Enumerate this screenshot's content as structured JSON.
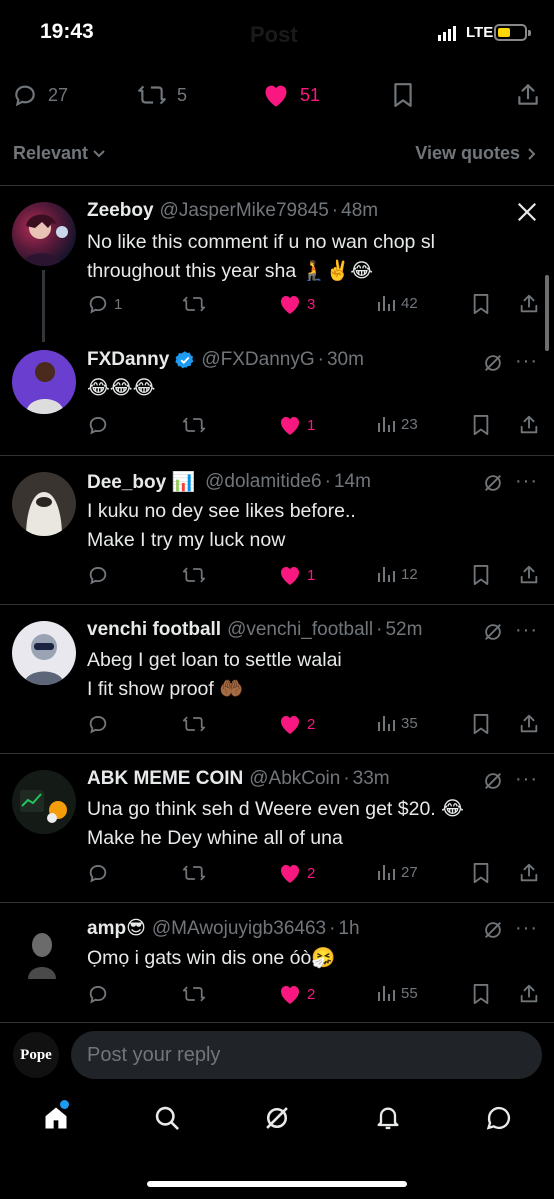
{
  "status_bar": {
    "time": "19:43",
    "network": "LTE",
    "ghost_title": "Post"
  },
  "post_actions": {
    "replies": "27",
    "reposts": "5",
    "likes": "51"
  },
  "sort": {
    "label": "Relevant",
    "view_quotes": "View quotes"
  },
  "tweets": [
    {
      "name": "Zeeboy",
      "handle": "@JasperMike79845",
      "ago": "48m",
      "lines": [
        "No like this comment if u no wan chop sl",
        "throughout this year sha 🧎✌️😂"
      ],
      "replies": "1",
      "reposts": "",
      "likes": "3",
      "views": "42"
    },
    {
      "name": "FXDanny",
      "handle": "@FXDannyG",
      "ago": "30m",
      "lines": [
        "😂😂😂"
      ],
      "replies": "",
      "reposts": "",
      "likes": "1",
      "views": "23"
    },
    {
      "name": "Dee_boy 📊",
      "handle": "@dolamitide6",
      "ago": "14m",
      "lines": [
        "I kuku no dey see likes before..",
        "Make I try my luck now"
      ],
      "replies": "",
      "reposts": "",
      "likes": "1",
      "views": "12"
    },
    {
      "name": "venchi football",
      "handle": "@venchi_football",
      "ago": "52m",
      "lines": [
        "Abeg I get loan to settle walai",
        "I fit show proof 🤲🏾"
      ],
      "replies": "",
      "reposts": "",
      "likes": "2",
      "views": "35"
    },
    {
      "name": "ABK MEME COIN",
      "handle": "@AbkCoin",
      "ago": "33m",
      "lines": [
        "Una go think seh d Weere even get $20. 😂",
        "Make he Dey whine all of una"
      ],
      "replies": "",
      "reposts": "",
      "likes": "2",
      "views": "27"
    },
    {
      "name": "amp😎",
      "handle": "@MAwojuyigb36463",
      "ago": "1h",
      "lines": [
        "Ọmọ i gats win dis one óò🤧"
      ],
      "replies": "",
      "reposts": "",
      "likes": "2",
      "views": "55"
    }
  ],
  "reply": {
    "avatar_text": "Pope",
    "placeholder": "Post your reply"
  },
  "colors": {
    "background": "#000000",
    "like": "#f91880",
    "muted": "#71767b",
    "verified": "#1d9bf0",
    "battery": "#ffd60a"
  },
  "icons": [
    "reply-icon",
    "repost-icon",
    "heart-icon",
    "bookmark-icon",
    "share-icon",
    "views-icon",
    "grok-icon",
    "more-icon",
    "x-logo-icon",
    "home-icon",
    "search-icon",
    "notifications-icon",
    "messages-icon"
  ]
}
